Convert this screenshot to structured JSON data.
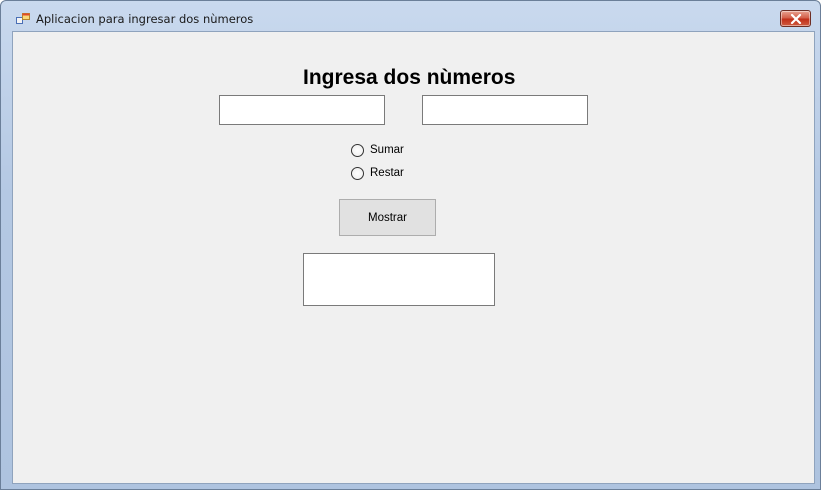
{
  "window": {
    "title": "Aplicacion para ingresar dos nùmeros"
  },
  "form": {
    "heading": "Ingresa dos nùmeros",
    "first_number": "",
    "second_number": "",
    "options": [
      {
        "label": "Sumar",
        "checked": false
      },
      {
        "label": "Restar",
        "checked": false
      }
    ],
    "show_button_label": "Mostrar",
    "result_text": ""
  },
  "colors": {
    "client_background": "#f0f0f0",
    "close_button": "#c7391f",
    "button_face": "#e1e1e1"
  }
}
